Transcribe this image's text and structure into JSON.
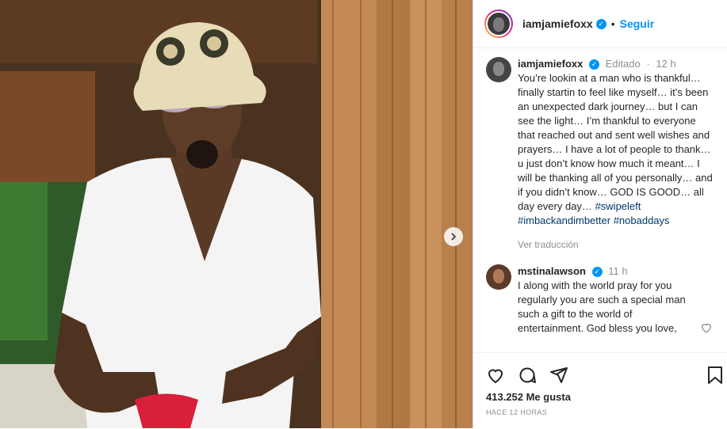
{
  "post": {
    "username": "iamjamiefoxx",
    "follow_label": "Seguir",
    "separator": "•"
  },
  "caption": {
    "username": "iamjamiefoxx",
    "edited": "Editado",
    "time": "12 h",
    "text": "You’re lookin at a man who is thankful… finally startin to feel like myself… it’s been an unexpected dark journey… but I can see the light… I’m thankful to everyone that reached out and sent well wishes and prayers… I have a lot of people to thank… u just don’t know how much it meant… I will be thanking all of you personally… and if you didn’t know… GOD IS GOOD… all day every day…",
    "hashtags": [
      "#swipeleft",
      "#imbackandimbetter",
      "#nobaddays"
    ],
    "translate": "Ver traducción"
  },
  "comment": {
    "username": "mstinalawson",
    "time": "11 h",
    "text": "I along with the world pray for you regularly you are such a special man such a gift to the world of entertainment. God bless you love,"
  },
  "stats": {
    "likes": "413.252 Me gusta",
    "posted": "HACE 12 HORAS"
  },
  "colors": {
    "accent": "#0095f6",
    "hashtag": "#00376b",
    "muted": "#8e8e8e"
  }
}
